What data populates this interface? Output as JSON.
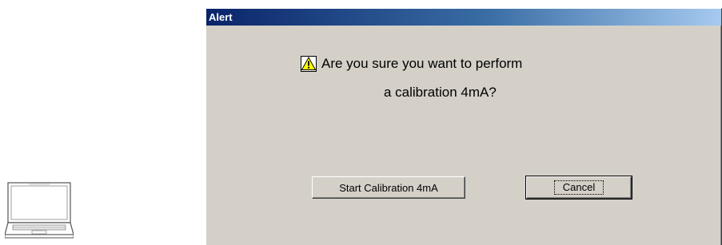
{
  "dialog": {
    "title": "Alert",
    "message_line1": "Are you sure you want to perform",
    "message_line2": "a calibration 4mA?",
    "start_label": "Start Calibration 4mA",
    "cancel_label": "Cancel",
    "icon": "warning-icon",
    "title_colors": [
      "#0a246a",
      "#a6caf0"
    ]
  },
  "illustration": {
    "icon": "laptop-icon"
  }
}
